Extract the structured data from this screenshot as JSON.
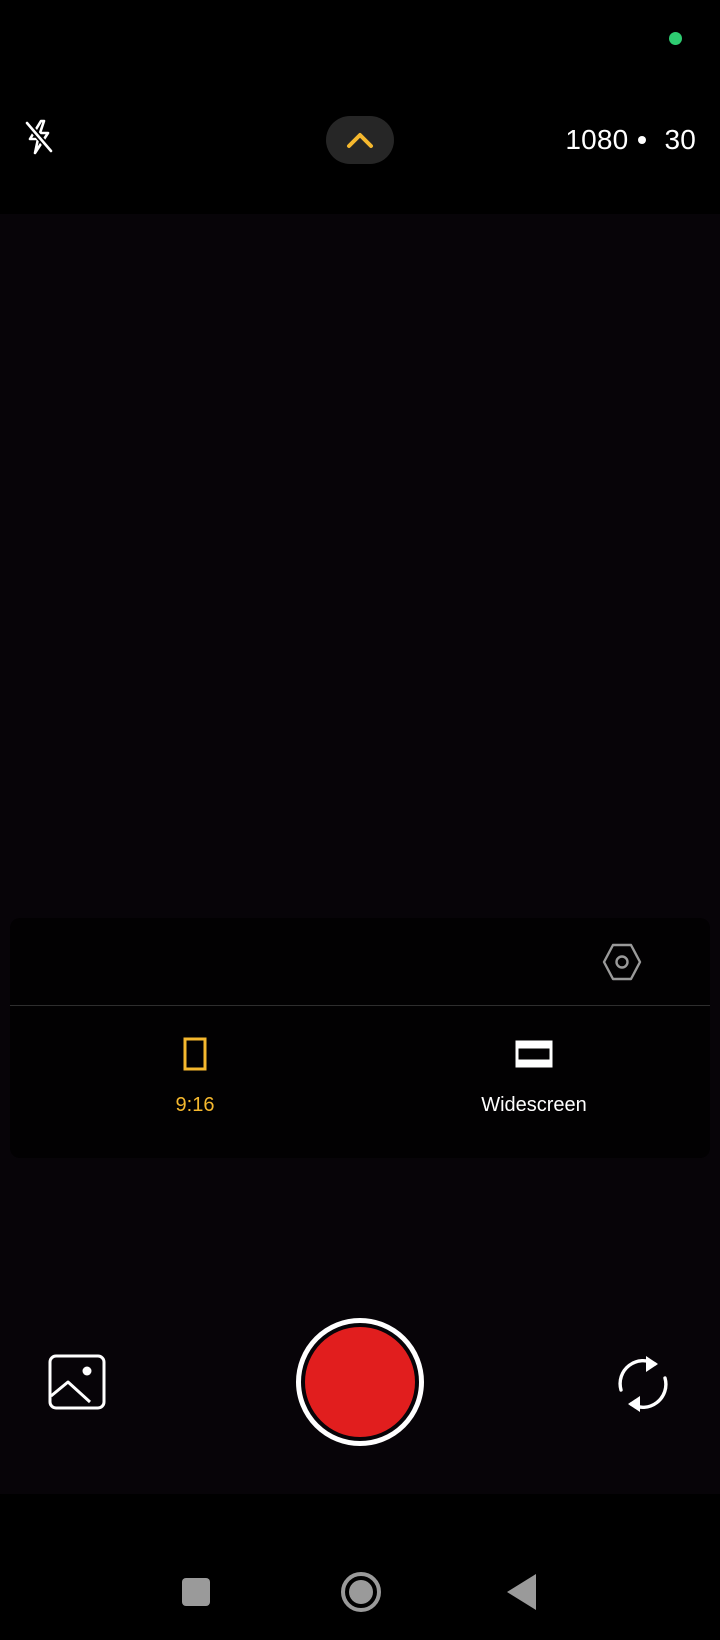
{
  "colors": {
    "accent": "#f5b82e",
    "record": "#e11e1e",
    "privacy_indicator": "#2ecc71",
    "nav_icon": "#9a9a9a"
  },
  "status_bar": {
    "privacy_indicator_icon": "camera-in-use-dot"
  },
  "top_bar": {
    "flash_icon": "flash-off-icon",
    "expand_icon": "chevron-up-icon",
    "resolution": "1080",
    "frame_rate": "30"
  },
  "aspect_panel": {
    "settings_icon": "hexagon-settings-icon",
    "options": [
      {
        "label": "9:16",
        "icon": "portrait-frame-icon",
        "selected": true
      },
      {
        "label": "Widescreen",
        "icon": "widescreen-frame-icon",
        "selected": false
      }
    ]
  },
  "bottom_controls": {
    "gallery_icon": "gallery-icon",
    "shutter": "record-button",
    "switch_icon": "switch-camera-icon"
  },
  "nav_bar": {
    "items": [
      "recents",
      "home",
      "back"
    ]
  }
}
